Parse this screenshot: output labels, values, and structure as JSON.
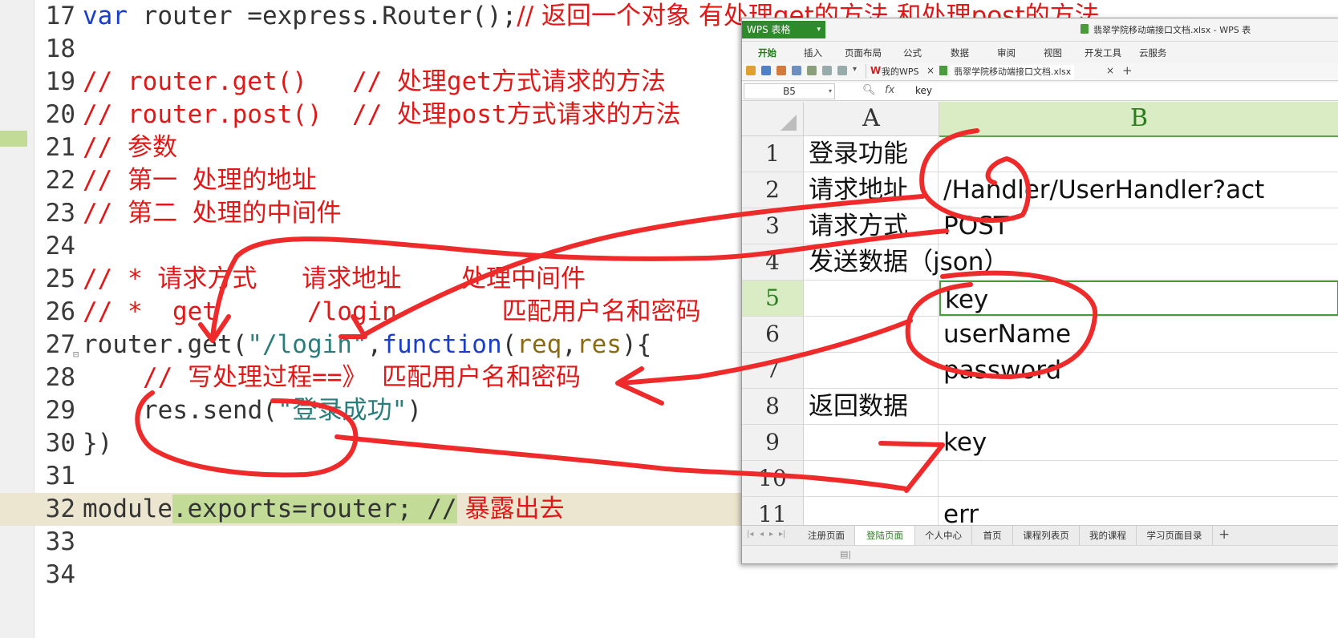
{
  "editor": {
    "lines": [
      {
        "num": "17"
      },
      {
        "num": "18"
      },
      {
        "num": "19"
      },
      {
        "num": "20"
      },
      {
        "num": "21"
      },
      {
        "num": "22"
      },
      {
        "num": "23"
      },
      {
        "num": "24"
      },
      {
        "num": "25"
      },
      {
        "num": "26"
      },
      {
        "num": "27"
      },
      {
        "num": "28"
      },
      {
        "num": "29"
      },
      {
        "num": "30"
      },
      {
        "num": "31"
      },
      {
        "num": "32"
      },
      {
        "num": "33"
      },
      {
        "num": "34"
      }
    ],
    "l17": {
      "kw": "var",
      "rest": " router =express.Router();",
      "comment": "// 返回一个对象 有处理get的方法 和处理post的方法"
    },
    "l19": {
      "comment": "// router.get()   // 处理get方式请求的方法"
    },
    "l20": {
      "comment": "// router.post()  // 处理post方式请求的方法"
    },
    "l21": {
      "comment": "// 参数"
    },
    "l22": {
      "comment": "// 第一 处理的地址"
    },
    "l23": {
      "comment": "// 第二 处理的中间件"
    },
    "l25": {
      "comment": "// * 请求方式   请求地址    处理中间件"
    },
    "l26": {
      "comment": "// *  get      /login       匹配用户名和密码"
    },
    "l27": {
      "a": "router.get(",
      "str": "\"/login\"",
      "b": ",",
      "kw": "function",
      "c": "(",
      "p1": "req",
      "d": ",",
      "p2": "res",
      "e": "){"
    },
    "l28": {
      "comment": "// 写处理过程==》 匹配用户名和密码"
    },
    "l29": {
      "a": "res.send(",
      "str": "\"登录成功\"",
      "b": ")"
    },
    "l30": {
      "a": "})"
    },
    "l32": {
      "a": "module",
      "b": ".exports=router; //",
      "comment": " 暴露出去"
    }
  },
  "wps": {
    "app_button": "WPS 表格",
    "window_title": "翡翠学院移动端接口文档.xlsx - WPS 表",
    "menu": [
      "开始",
      "插入",
      "页面布局",
      "公式",
      "数据",
      "审阅",
      "视图",
      "开发工具",
      "云服务"
    ],
    "doc_tabs": [
      {
        "label": "我的WPS"
      },
      {
        "label": "翡翠学院移动端接口文档.xlsx"
      }
    ],
    "name_box": "B5",
    "formula_value": "key",
    "columns": [
      "A",
      "B"
    ],
    "rows": [
      {
        "n": "1",
        "a": "登录功能",
        "b": ""
      },
      {
        "n": "2",
        "a": "请求地址",
        "b": "/Handler/UserHandler?act"
      },
      {
        "n": "3",
        "a": "请求方式",
        "b": "POST"
      },
      {
        "n": "4",
        "a": "发送数据（json）",
        "b": ""
      },
      {
        "n": "5",
        "a": "",
        "b": "key"
      },
      {
        "n": "6",
        "a": "",
        "b": "userName"
      },
      {
        "n": "7",
        "a": "",
        "b": "password"
      },
      {
        "n": "8",
        "a": "返回数据",
        "b": ""
      },
      {
        "n": "9",
        "a": "",
        "b": "key"
      },
      {
        "n": "10",
        "a": "",
        "b": ""
      },
      {
        "n": "11",
        "a": "",
        "b": "err"
      }
    ],
    "sheets": [
      "注册页面",
      "登陆页面",
      "个人中心",
      "首页",
      "课程列表页",
      "我的课程",
      "学习页面目录"
    ],
    "active_sheet": "登陆页面"
  },
  "colors": {
    "comment": "#e01818",
    "keyword": "#1a3ec8",
    "string": "#2a7d7d",
    "param": "#8a6a12",
    "highlight": "#c2dc98",
    "wps_green": "#2e8b2a",
    "annotation": "#ee2a2a"
  }
}
